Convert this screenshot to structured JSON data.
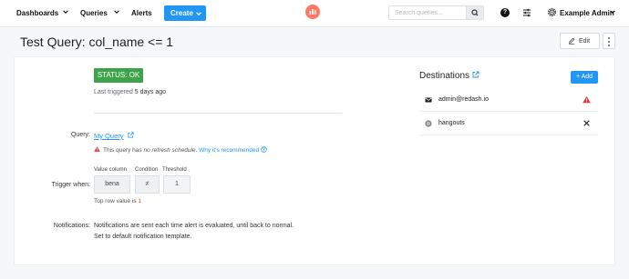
{
  "nav": {
    "dashboards": "Dashboards",
    "queries": "Queries",
    "alerts": "Alerts",
    "create": "Create",
    "search_placeholder": "Search queries...",
    "user": "Example Admin"
  },
  "page": {
    "title": "Test Query: col_name <= 1",
    "edit_label": "Edit"
  },
  "alert": {
    "status": "STATUS: OK",
    "last_triggered_prefix": "Last triggered",
    "last_triggered_value": "5 days ago",
    "query_label": "Query:",
    "query_name": "My Query",
    "warning_prefix": "This query has",
    "warning_em": "no refresh schedule",
    "warning_suffix": ".",
    "warning_link": "Why it's recommended",
    "trigger_label": "Trigger when:",
    "trigger": {
      "headers": [
        "Value column",
        "Condition",
        "Threshold"
      ],
      "values": [
        "bena",
        "≠",
        "1"
      ]
    },
    "top_row_prefix": "Top row value is",
    "top_row_value": "1",
    "notifications_label": "Notifications:",
    "notifications_line1": "Notifications are sent each time alert is evaluated, until back to normal.",
    "notifications_line2": "Set to default notification template."
  },
  "destinations": {
    "title": "Destinations",
    "add_label": "Add",
    "items": [
      {
        "name": "admin@redash.io",
        "icon": "email-icon",
        "status_icon": "warning-icon"
      },
      {
        "name": "hangouts",
        "icon": "hangouts-icon",
        "status_icon": "close-icon"
      }
    ]
  },
  "colors": {
    "accent": "#2196f3",
    "status_ok": "#3ea44c",
    "warning": "#e53935",
    "logo": "#ff7964"
  }
}
